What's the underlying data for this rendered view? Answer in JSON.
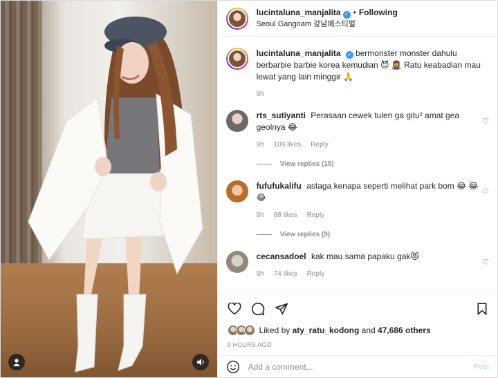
{
  "header": {
    "username": "lucintaluna_manjalita",
    "separator": "•",
    "following_label": "Following",
    "location": "Seoul Gangnam 강남페스티벌"
  },
  "caption": {
    "username": "lucintaluna_manjalita",
    "text": "bermonster monster dahulu berbarbie barbie korea kemudian 😈 🧟‍♀️ Ratu keabadian mau lewat yang lain minggir 🙏",
    "time": "9h"
  },
  "comments": [
    {
      "username": "rts_sutiyanti",
      "text": "Perasaan cewek tulen ga gitu² amat gea geolnya 😂",
      "time": "9h",
      "likes": "109 likes",
      "reply_label": "Reply",
      "view_replies": "View replies (15)"
    },
    {
      "username": "fufufukalifu",
      "text": "astaga kenapa seperti melihat park bom 😂 😂 😂",
      "time": "9h",
      "likes": "88 likes",
      "reply_label": "Reply",
      "view_replies": "View replies (9)"
    },
    {
      "username": "cecansadoel",
      "text": "kak mau sama papaku gak😻",
      "time": "9h",
      "likes": "74 likes",
      "reply_label": "Reply"
    }
  ],
  "likes_line": {
    "prefix": "Liked by",
    "user": "aty_ratu_kodong",
    "and": "and",
    "others": "47,686 others"
  },
  "posted_ago": "9 HOURS AGO",
  "add_comment": {
    "placeholder": "Add a comment...",
    "post_label": "Post"
  },
  "icons": [
    "heart-icon",
    "comment-icon",
    "share-icon",
    "bookmark-icon",
    "emoji-icon",
    "user-tag-icon",
    "sound-icon",
    "verified-icon"
  ],
  "colors": {
    "verified": "#3897f0",
    "post_disabled": "#b3dbff",
    "muted": "#8e8e8e"
  }
}
